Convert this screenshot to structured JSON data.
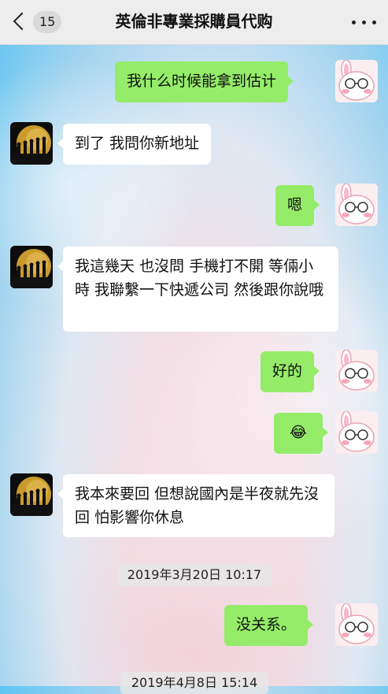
{
  "header": {
    "unread_count": "15",
    "title": "英倫非專業採購員代购"
  },
  "messages": [
    {
      "sender": "me",
      "text": "我什么时候能拿到估计"
    },
    {
      "sender": "contact",
      "text": "到了 我問你新地址"
    },
    {
      "sender": "me",
      "text": "嗯"
    },
    {
      "sender": "contact",
      "text": "我這幾天 也沒問 手機打不開 等倆小時 我聯繫一下快遞公司 然後跟你說哦"
    },
    {
      "sender": "me",
      "text": "好的"
    },
    {
      "sender": "me",
      "text": "😂"
    },
    {
      "sender": "contact",
      "text": "我本來要回 但想說國內是半夜就先沒回 怕影響你休息"
    },
    {
      "sender": "system",
      "text": "2019年3月20日 10:17"
    },
    {
      "sender": "me",
      "text": "没关系。"
    },
    {
      "sender": "system",
      "text": "2019年4月8日 15:14"
    }
  ],
  "icons": {
    "back": "chevron-left-icon",
    "more": "more-dots-icon",
    "my_avatar": "pink-bunny-avatar",
    "contact_avatar": "evolution-silhouette-avatar"
  },
  "colors": {
    "my_bubble": "#95ec69",
    "their_bubble": "#ffffff",
    "header_bg": "#ededed"
  }
}
